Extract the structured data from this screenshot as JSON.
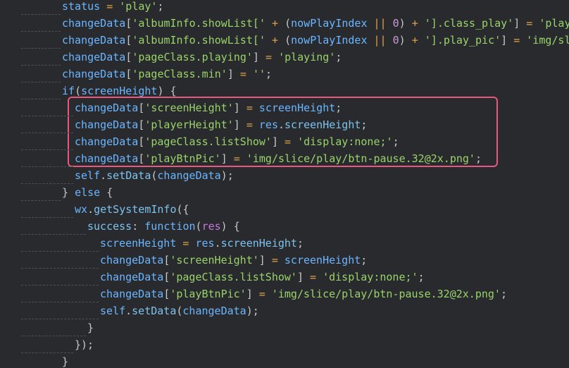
{
  "editor": {
    "lines": [
      {
        "indent": 0,
        "tokens": [
          [
            "var",
            "status"
          ],
          [
            "op",
            " = "
          ],
          [
            "str",
            "'play'"
          ],
          [
            "punc",
            ";"
          ]
        ]
      },
      {
        "indent": 0,
        "tokens": [
          [
            "var",
            "changeData"
          ],
          [
            "punc",
            "["
          ],
          [
            "str",
            "'albumInfo.showList['"
          ],
          [
            "op",
            " + "
          ],
          [
            "punc",
            "("
          ],
          [
            "var",
            "nowPlayIndex"
          ],
          [
            "op",
            " || "
          ],
          [
            "num",
            "0"
          ],
          [
            "punc",
            ")"
          ],
          [
            "op",
            " + "
          ],
          [
            "str",
            "'].class_play'"
          ],
          [
            "punc",
            "]"
          ],
          [
            "op",
            " = "
          ],
          [
            "str",
            "'play"
          ]
        ]
      },
      {
        "indent": 0,
        "tokens": [
          [
            "var",
            "changeData"
          ],
          [
            "punc",
            "["
          ],
          [
            "str",
            "'albumInfo.showList['"
          ],
          [
            "op",
            " + "
          ],
          [
            "punc",
            "("
          ],
          [
            "var",
            "nowPlayIndex"
          ],
          [
            "op",
            " || "
          ],
          [
            "num",
            "0"
          ],
          [
            "punc",
            ")"
          ],
          [
            "op",
            " + "
          ],
          [
            "str",
            "'].play_pic'"
          ],
          [
            "punc",
            "]"
          ],
          [
            "op",
            " = "
          ],
          [
            "str",
            "'img/sl"
          ]
        ]
      },
      {
        "indent": 0,
        "tokens": [
          [
            "var",
            "changeData"
          ],
          [
            "punc",
            "["
          ],
          [
            "str",
            "'pageClass.playing'"
          ],
          [
            "punc",
            "]"
          ],
          [
            "op",
            " = "
          ],
          [
            "str",
            "'playing'"
          ],
          [
            "punc",
            ";"
          ]
        ]
      },
      {
        "indent": 0,
        "tokens": [
          [
            "var",
            "changeData"
          ],
          [
            "punc",
            "["
          ],
          [
            "str",
            "'pageClass.min'"
          ],
          [
            "punc",
            "]"
          ],
          [
            "op",
            " = "
          ],
          [
            "str",
            "''"
          ],
          [
            "punc",
            ";"
          ]
        ]
      },
      {
        "indent": 0,
        "tokens": [
          [
            "kw",
            "if"
          ],
          [
            "punc",
            "("
          ],
          [
            "var",
            "screenHeight"
          ],
          [
            "punc",
            ") {"
          ]
        ]
      },
      {
        "indent": 1,
        "tokens": [
          [
            "var",
            "changeData"
          ],
          [
            "punc",
            "["
          ],
          [
            "str",
            "'screenHeight'"
          ],
          [
            "punc",
            "]"
          ],
          [
            "op",
            " = "
          ],
          [
            "var",
            "screenHeight"
          ],
          [
            "punc",
            ";"
          ]
        ]
      },
      {
        "indent": 1,
        "tokens": [
          [
            "var",
            "changeData"
          ],
          [
            "punc",
            "["
          ],
          [
            "str",
            "'playerHeight'"
          ],
          [
            "punc",
            "]"
          ],
          [
            "op",
            " = "
          ],
          [
            "var",
            "res"
          ],
          [
            "punc",
            "."
          ],
          [
            "prop",
            "screenHeight"
          ],
          [
            "punc",
            ";"
          ]
        ]
      },
      {
        "indent": 1,
        "tokens": [
          [
            "var",
            "changeData"
          ],
          [
            "punc",
            "["
          ],
          [
            "str",
            "'pageClass.listShow'"
          ],
          [
            "punc",
            "]"
          ],
          [
            "op",
            " = "
          ],
          [
            "str",
            "'display:none;'"
          ],
          [
            "punc",
            ";"
          ]
        ]
      },
      {
        "indent": 1,
        "tokens": [
          [
            "var",
            "changeData"
          ],
          [
            "punc",
            "["
          ],
          [
            "str",
            "'playBtnPic'"
          ],
          [
            "punc",
            "]"
          ],
          [
            "op",
            " = "
          ],
          [
            "str",
            "'img/slice/play/btn-pause.32@2x.png'"
          ],
          [
            "punc",
            ";"
          ]
        ]
      },
      {
        "indent": 1,
        "tokens": [
          [
            "var",
            "self"
          ],
          [
            "punc",
            "."
          ],
          [
            "fn",
            "setData"
          ],
          [
            "punc",
            "("
          ],
          [
            "var",
            "changeData"
          ],
          [
            "punc",
            ");"
          ]
        ]
      },
      {
        "indent": 0,
        "tokens": [
          [
            "punc",
            "} "
          ],
          [
            "kw",
            "else"
          ],
          [
            "punc",
            " {"
          ]
        ]
      },
      {
        "indent": 1,
        "tokens": [
          [
            "var",
            "wx"
          ],
          [
            "punc",
            "."
          ],
          [
            "fn",
            "getSystemInfo"
          ],
          [
            "punc",
            "({"
          ]
        ]
      },
      {
        "indent": 2,
        "tokens": [
          [
            "prop",
            "success"
          ],
          [
            "punc",
            ": "
          ],
          [
            "kw",
            "function"
          ],
          [
            "punc",
            "("
          ],
          [
            "param",
            "res"
          ],
          [
            "punc",
            ") {"
          ]
        ]
      },
      {
        "indent": 3,
        "tokens": [
          [
            "var",
            "screenHeight"
          ],
          [
            "op",
            " = "
          ],
          [
            "var",
            "res"
          ],
          [
            "punc",
            "."
          ],
          [
            "prop",
            "screenHeight"
          ],
          [
            "punc",
            ";"
          ]
        ]
      },
      {
        "indent": 3,
        "tokens": [
          [
            "var",
            "changeData"
          ],
          [
            "punc",
            "["
          ],
          [
            "str",
            "'screenHeight'"
          ],
          [
            "punc",
            "]"
          ],
          [
            "op",
            " = "
          ],
          [
            "var",
            "screenHeight"
          ],
          [
            "punc",
            ";"
          ]
        ]
      },
      {
        "indent": 3,
        "tokens": [
          [
            "var",
            "changeData"
          ],
          [
            "punc",
            "["
          ],
          [
            "str",
            "'pageClass.listShow'"
          ],
          [
            "punc",
            "]"
          ],
          [
            "op",
            " = "
          ],
          [
            "str",
            "'display:none;'"
          ],
          [
            "punc",
            ";"
          ]
        ]
      },
      {
        "indent": 3,
        "tokens": [
          [
            "var",
            "changeData"
          ],
          [
            "punc",
            "["
          ],
          [
            "str",
            "'playBtnPic'"
          ],
          [
            "punc",
            "]"
          ],
          [
            "op",
            " = "
          ],
          [
            "str",
            "'img/slice/play/btn-pause.32@2x.png'"
          ],
          [
            "punc",
            ";"
          ]
        ]
      },
      {
        "indent": 3,
        "tokens": [
          [
            "var",
            "self"
          ],
          [
            "punc",
            "."
          ],
          [
            "fn",
            "setData"
          ],
          [
            "punc",
            "("
          ],
          [
            "var",
            "changeData"
          ],
          [
            "punc",
            ");"
          ]
        ]
      },
      {
        "indent": 2,
        "tokens": [
          [
            "punc",
            "}"
          ]
        ]
      },
      {
        "indent": 1,
        "tokens": [
          [
            "punc",
            "});"
          ]
        ]
      },
      {
        "indent": 0,
        "tokens": [
          [
            "punc",
            "}"
          ]
        ]
      }
    ],
    "highlighted_lines": [
      6,
      9
    ],
    "highlight_color": "#e8577d",
    "colors": {
      "background": "#282a2e",
      "string": "#9ad36a",
      "variable": "#6cb6ff",
      "operator": "#e0a34a",
      "number": "#c89ad8",
      "parameter": "#c678dd"
    }
  }
}
